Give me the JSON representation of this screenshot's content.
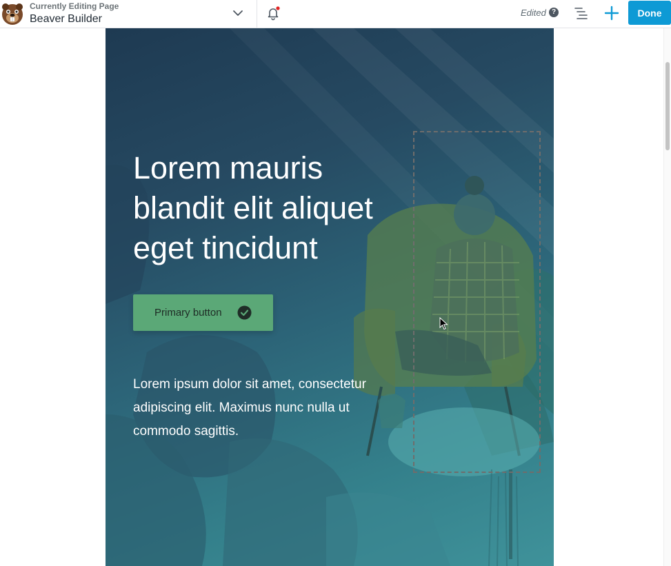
{
  "topbar": {
    "subtitle": "Currently Editing Page",
    "title": "Beaver Builder",
    "status": "Edited",
    "help_glyph": "?",
    "done_label": "Done",
    "icons": [
      "beaver-logo-icon",
      "chevron-down-icon",
      "bell-icon",
      "help-icon",
      "outline-list-icon",
      "plus-icon"
    ],
    "accent_color": "#0e9ad5",
    "notification_dot_color": "#e02424"
  },
  "hero": {
    "headline": "Lorem mauris blandit elit aliquet eget tincidunt",
    "button_label": "Primary button",
    "button_color": "#5ba877",
    "body": "Lorem ipsum dolor sit amet, consectetur adipiscing elit. Maximus nunc nulla ut commodo sagittis."
  }
}
